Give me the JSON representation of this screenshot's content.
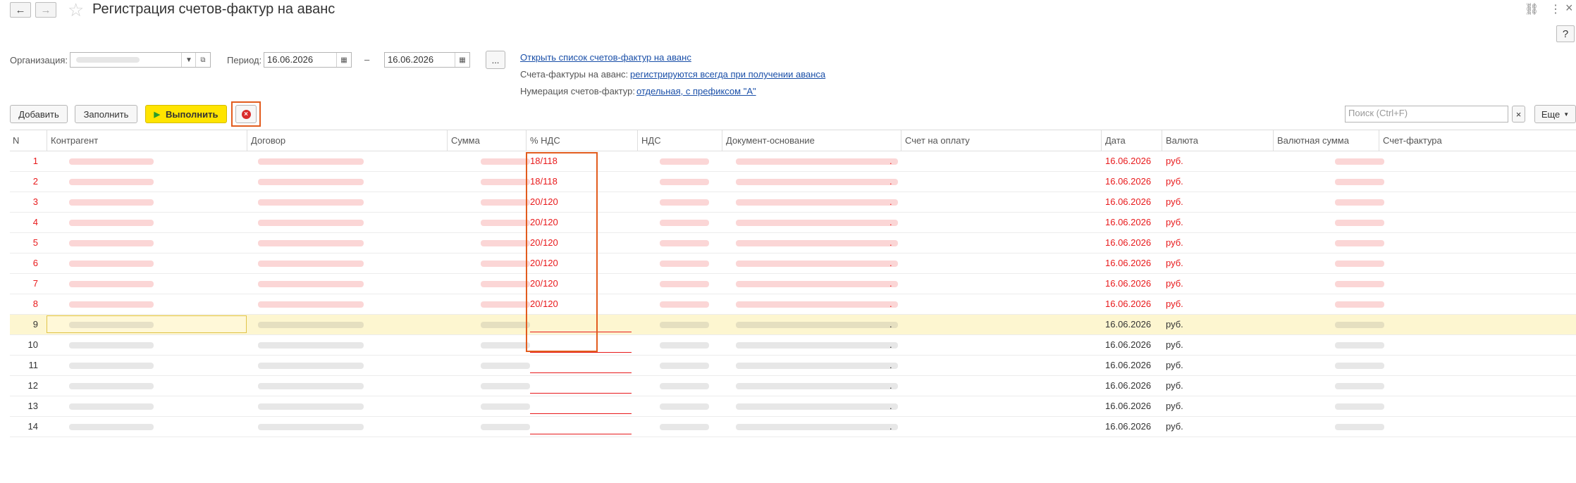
{
  "window": {
    "title": "Регистрация счетов-фактур на аванс",
    "back_icon": "←",
    "forward_icon": "→",
    "link_icon": "⛓",
    "more_icon": "⋮",
    "close_icon": "×",
    "help_label": "?"
  },
  "filters": {
    "organization_label": "Организация:",
    "period_label": "Период:",
    "date_from": "16.06.2026",
    "date_to": "16.06.2026",
    "dash": "–",
    "ellipsis_label": "...",
    "open_list_link": "Открыть список счетов-фактур на аванс",
    "invoices_label": "Счета-фактуры на аванс:",
    "invoices_link": "регистрируются всегда при получении аванса",
    "numbering_label": "Нумерация счетов-фактур:",
    "numbering_link": "отдельная, с префиксом \"А\""
  },
  "toolbar": {
    "add_label": "Добавить",
    "fill_label": "Заполнить",
    "run_label": "Выполнить",
    "search_placeholder": "Поиск (Ctrl+F)",
    "more_label": "Еще"
  },
  "table": {
    "headers": [
      "N",
      "Контрагент",
      "Договор",
      "Сумма",
      "% НДС",
      "НДС",
      "Документ-основание",
      "Счет на оплату",
      "Дата",
      "Валюта",
      "Валютная сумма",
      "Счет-фактура"
    ],
    "rows": [
      {
        "n": "1",
        "vat_rate": "18/118",
        "date": "16.06.2026",
        "currency": "руб.",
        "error": true,
        "selected": false
      },
      {
        "n": "2",
        "vat_rate": "18/118",
        "date": "16.06.2026",
        "currency": "руб.",
        "error": true,
        "selected": false
      },
      {
        "n": "3",
        "vat_rate": "20/120",
        "date": "16.06.2026",
        "currency": "руб.",
        "error": true,
        "selected": false
      },
      {
        "n": "4",
        "vat_rate": "20/120",
        "date": "16.06.2026",
        "currency": "руб.",
        "error": true,
        "selected": false
      },
      {
        "n": "5",
        "vat_rate": "20/120",
        "date": "16.06.2026",
        "currency": "руб.",
        "error": true,
        "selected": false
      },
      {
        "n": "6",
        "vat_rate": "20/120",
        "date": "16.06.2026",
        "currency": "руб.",
        "error": true,
        "selected": false
      },
      {
        "n": "7",
        "vat_rate": "20/120",
        "date": "16.06.2026",
        "currency": "руб.",
        "error": true,
        "selected": false
      },
      {
        "n": "8",
        "vat_rate": "20/120",
        "date": "16.06.2026",
        "currency": "руб.",
        "error": true,
        "selected": false
      },
      {
        "n": "9",
        "vat_rate": "",
        "date": "16.06.2026",
        "currency": "руб.",
        "error": false,
        "selected": true
      },
      {
        "n": "10",
        "vat_rate": "",
        "date": "16.06.2026",
        "currency": "руб.",
        "error": false,
        "selected": false
      },
      {
        "n": "11",
        "vat_rate": "",
        "date": "16.06.2026",
        "currency": "руб.",
        "error": false,
        "selected": false
      },
      {
        "n": "12",
        "vat_rate": "",
        "date": "16.06.2026",
        "currency": "руб.",
        "error": false,
        "selected": false
      },
      {
        "n": "13",
        "vat_rate": "",
        "date": "16.06.2026",
        "currency": "руб.",
        "error": false,
        "selected": false
      },
      {
        "n": "14",
        "vat_rate": "",
        "date": "16.06.2026",
        "currency": "руб.",
        "error": false,
        "selected": false
      }
    ]
  },
  "colors": {
    "error": "#e8191b",
    "selected_row": "#fdf6d0",
    "highlight_frame": "#e25c1e",
    "run_button": "#ffe400",
    "link": "#1a4fa8"
  }
}
